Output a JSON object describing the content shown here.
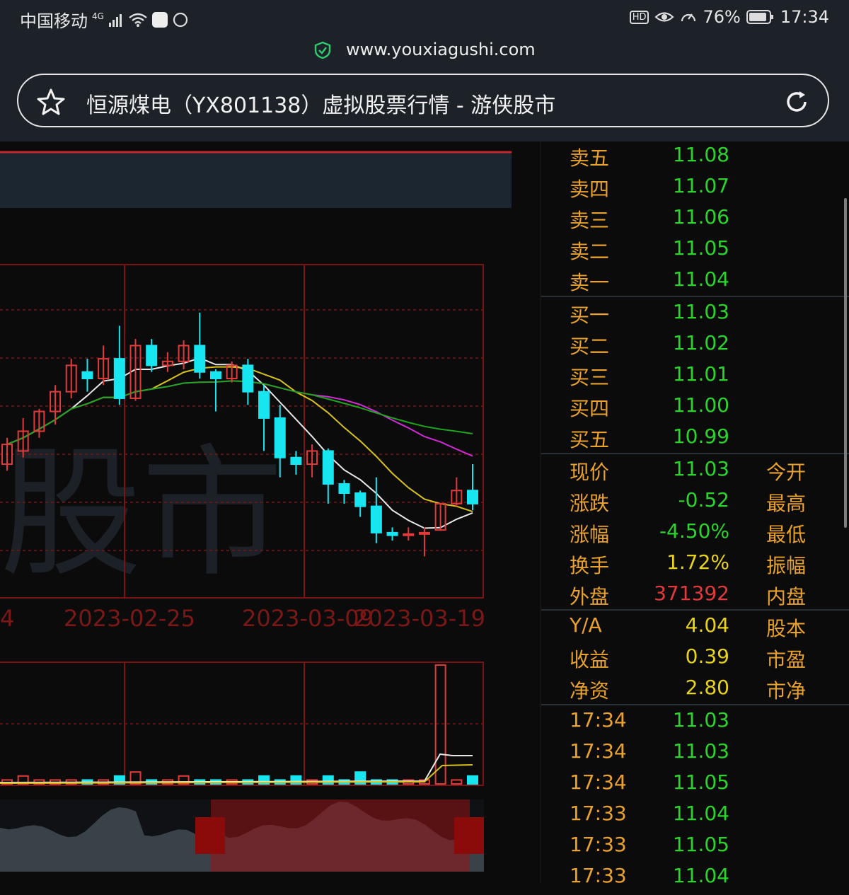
{
  "status": {
    "carrier": "中国移动",
    "network": "4G",
    "battery_pct": "76%",
    "time": "17:34",
    "hd": "HD"
  },
  "browser": {
    "domain": "www.youxiagushi.com",
    "page_title": "恒源煤电（YX801138）虚拟股票行情 - 游侠股市"
  },
  "chart": {
    "watermark": "股市",
    "date_labels": [
      "4",
      "2023-02-25",
      "2023-03-09",
      "2023-03-19"
    ],
    "colors": {
      "up": "#e03a3a",
      "down": "#17e6f1",
      "ma5": "#e8e8e8",
      "ma10": "#d8c21a",
      "ma20": "#d12ad6",
      "ma30": "#1ea51e",
      "grid": "#7a1414"
    }
  },
  "chart_data": {
    "type": "candlestick",
    "x": [
      "",
      "",
      "",
      "",
      "",
      "",
      "",
      "",
      "",
      "",
      "",
      "",
      "",
      "",
      "",
      "",
      "",
      "",
      "",
      "",
      "",
      "",
      "",
      "",
      "",
      "",
      "",
      "",
      "",
      ""
    ],
    "x_tick_labels": [
      "4",
      "2023-02-25",
      "2023-03-09",
      "2023-03-19"
    ],
    "y_unit": "price",
    "series": [
      {
        "values": [
          [
            11.3,
            11.45,
            11.25,
            11.5
          ],
          [
            11.4,
            11.55,
            11.35,
            11.65
          ],
          [
            11.55,
            11.7,
            11.5,
            11.72
          ],
          [
            11.7,
            11.85,
            11.6,
            11.9
          ],
          [
            11.85,
            12.05,
            11.8,
            12.1
          ],
          [
            12.0,
            11.95,
            11.85,
            12.1
          ],
          [
            11.95,
            12.1,
            11.9,
            12.2
          ],
          [
            12.1,
            11.8,
            11.75,
            12.35
          ],
          [
            11.8,
            12.2,
            11.78,
            12.25
          ],
          [
            12.2,
            12.05,
            12.0,
            12.25
          ],
          [
            12.05,
            12.08,
            12.0,
            12.15
          ],
          [
            12.08,
            12.2,
            12.02,
            12.24
          ],
          [
            12.2,
            12.0,
            11.95,
            12.45
          ],
          [
            12.0,
            11.95,
            11.7,
            12.02
          ],
          [
            11.95,
            12.05,
            11.92,
            12.08
          ],
          [
            12.05,
            11.85,
            11.75,
            12.1
          ],
          [
            11.85,
            11.65,
            11.4,
            11.9
          ],
          [
            11.65,
            11.35,
            11.2,
            11.75
          ],
          [
            11.35,
            11.3,
            11.22,
            11.4
          ],
          [
            11.3,
            11.4,
            11.2,
            11.45
          ],
          [
            11.4,
            11.15,
            11.0,
            11.42
          ],
          [
            11.15,
            11.08,
            11.0,
            11.18
          ],
          [
            11.08,
            10.98,
            10.9,
            11.1
          ],
          [
            10.98,
            10.78,
            10.7,
            11.2
          ],
          [
            10.78,
            10.76,
            10.72,
            10.82
          ],
          [
            10.76,
            10.77,
            10.72,
            10.82
          ],
          [
            10.77,
            10.78,
            10.6,
            10.82
          ],
          [
            10.8,
            11.0,
            10.8,
            11.0
          ],
          [
            11.0,
            11.1,
            10.98,
            11.2
          ],
          [
            11.1,
            11.0,
            10.95,
            11.3
          ]
        ]
      }
    ]
  },
  "quote": {
    "sell": [
      {
        "label": "卖五",
        "price": "11.08"
      },
      {
        "label": "卖四",
        "price": "11.07"
      },
      {
        "label": "卖三",
        "price": "11.06"
      },
      {
        "label": "卖二",
        "price": "11.05"
      },
      {
        "label": "卖一",
        "price": "11.04"
      }
    ],
    "buy": [
      {
        "label": "买一",
        "price": "11.03"
      },
      {
        "label": "买二",
        "price": "11.02"
      },
      {
        "label": "买三",
        "price": "11.01"
      },
      {
        "label": "买四",
        "price": "11.00"
      },
      {
        "label": "买五",
        "price": "10.99"
      }
    ],
    "stats": [
      {
        "label": "现价",
        "value": "11.03",
        "label2": "今开",
        "color": "#2bd42b"
      },
      {
        "label": "涨跌",
        "value": "-0.52",
        "label2": "最高",
        "color": "#2bd42b"
      },
      {
        "label": "涨幅",
        "value": "-4.50%",
        "label2": "最低",
        "color": "#2bd42b"
      },
      {
        "label": "换手",
        "value": "1.72%",
        "label2": "振幅",
        "color": "#e8d21a"
      },
      {
        "label": "外盘",
        "value": "371392",
        "label2": "内盘",
        "color": "#e03a3a"
      }
    ],
    "fin": [
      {
        "label": "Y/A",
        "value": "4.04",
        "label2": "股本"
      },
      {
        "label": "收益",
        "value": "0.39",
        "label2": "市盈"
      },
      {
        "label": "净资",
        "value": "2.80",
        "label2": "市净"
      }
    ],
    "ticks": [
      {
        "time": "17:34",
        "price": "11.03"
      },
      {
        "time": "17:34",
        "price": "11.03"
      },
      {
        "time": "17:34",
        "price": "11.05"
      },
      {
        "time": "17:33",
        "price": "11.04"
      },
      {
        "time": "17:33",
        "price": "11.05"
      },
      {
        "time": "17:33",
        "price": "11.04"
      }
    ]
  }
}
